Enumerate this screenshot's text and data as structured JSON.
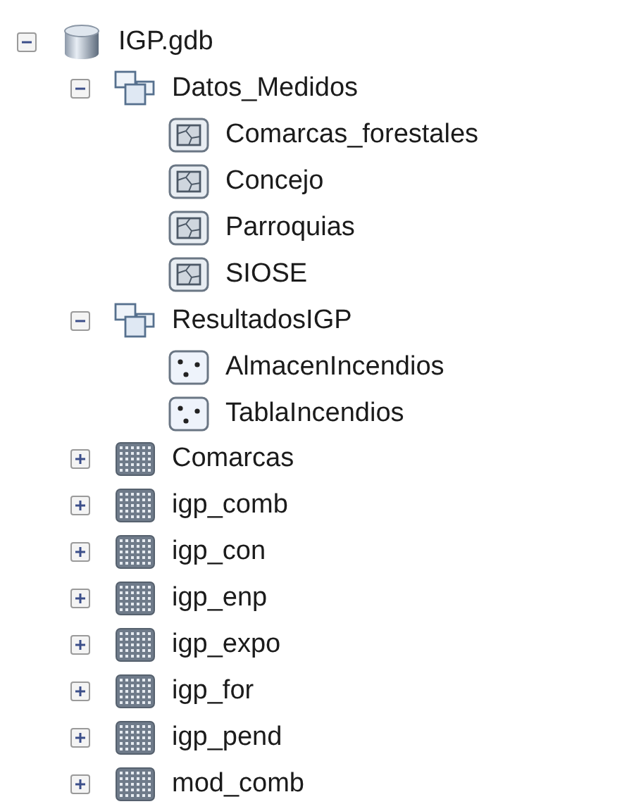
{
  "tree": [
    {
      "label": "IGP.gdb",
      "kind": "geodatabase",
      "expanded": true,
      "children": [
        {
          "label": "Datos_Medidos",
          "kind": "dataset",
          "expanded": true,
          "children": [
            {
              "label": "Comarcas_forestales",
              "kind": "polygon"
            },
            {
              "label": "Concejo",
              "kind": "polygon"
            },
            {
              "label": "Parroquias",
              "kind": "polygon"
            },
            {
              "label": "SIOSE",
              "kind": "polygon"
            }
          ]
        },
        {
          "label": "ResultadosIGP",
          "kind": "dataset",
          "expanded": true,
          "children": [
            {
              "label": "AlmacenIncendios",
              "kind": "point"
            },
            {
              "label": "TablaIncendios",
              "kind": "point"
            }
          ]
        },
        {
          "label": "Comarcas",
          "kind": "raster",
          "expanded": false
        },
        {
          "label": "igp_comb",
          "kind": "raster",
          "expanded": false
        },
        {
          "label": "igp_con",
          "kind": "raster",
          "expanded": false
        },
        {
          "label": "igp_enp",
          "kind": "raster",
          "expanded": false
        },
        {
          "label": "igp_expo",
          "kind": "raster",
          "expanded": false
        },
        {
          "label": "igp_for",
          "kind": "raster",
          "expanded": false
        },
        {
          "label": "igp_pend",
          "kind": "raster",
          "expanded": false
        },
        {
          "label": "mod_comb",
          "kind": "raster",
          "expanded": false
        }
      ]
    }
  ]
}
